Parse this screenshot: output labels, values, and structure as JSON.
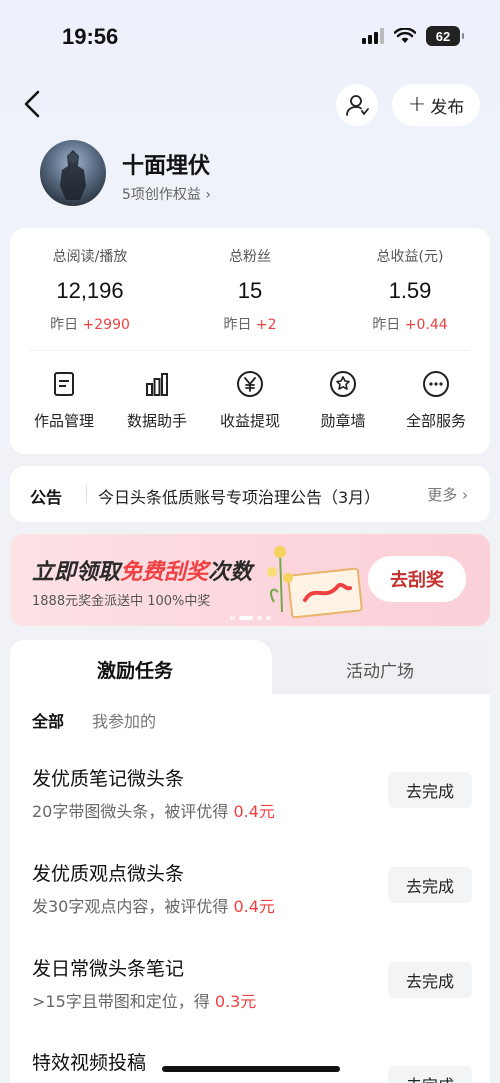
{
  "status": {
    "time": "19:56",
    "battery": "62"
  },
  "nav": {
    "publish_label": "发布",
    "publish_plus": "+"
  },
  "profile": {
    "name": "十面埋伏",
    "creator_link": "5项创作权益 ›"
  },
  "stats": [
    {
      "label": "总阅读/播放",
      "value": "12,196",
      "delta_prefix": "昨日 ",
      "delta": "+2990"
    },
    {
      "label": "总粉丝",
      "value": "15",
      "delta_prefix": "昨日 ",
      "delta": "+2"
    },
    {
      "label": "总收益(元)",
      "value": "1.59",
      "delta_prefix": "昨日 ",
      "delta": "+0.44"
    }
  ],
  "services": [
    {
      "label": "作品管理",
      "icon": "document-icon"
    },
    {
      "label": "数据助手",
      "icon": "bar-chart-icon"
    },
    {
      "label": "收益提现",
      "icon": "yen-icon"
    },
    {
      "label": "勋章墙",
      "icon": "badge-icon"
    },
    {
      "label": "全部服务",
      "icon": "more-icon"
    }
  ],
  "notice": {
    "tag": "公告",
    "text": "今日头条低质账号专项治理公告（3月）",
    "more": "更多 ›"
  },
  "banner": {
    "title_a": "立即领取",
    "title_hl": "免费刮奖",
    "title_b": "次数",
    "subtitle": "1888元奖金派送中 100%中奖",
    "button": "去刮奖"
  },
  "tabs": [
    {
      "label": "激励任务"
    },
    {
      "label": "活动广场"
    }
  ],
  "filters": {
    "all": "全部",
    "mine": "我参加的"
  },
  "tasks": [
    {
      "title": "发优质笔记微头条",
      "desc": "20字带图微头条，被评优得 ",
      "reward": "0.4元",
      "button": "去完成"
    },
    {
      "title": "发优质观点微头条",
      "desc": "发30字观点内容，被评优得 ",
      "reward": "0.4元",
      "button": "去完成"
    },
    {
      "title": "发日常微头条笔记",
      "desc": ">15字且带图和定位，得 ",
      "reward": "0.3元",
      "button": "去完成"
    },
    {
      "title": "特效视频投稿",
      "desc": "",
      "reward": "",
      "button": "去完成"
    }
  ],
  "colors": {
    "accent_red": "#f04142",
    "banner_button_text": "#c3302e"
  }
}
